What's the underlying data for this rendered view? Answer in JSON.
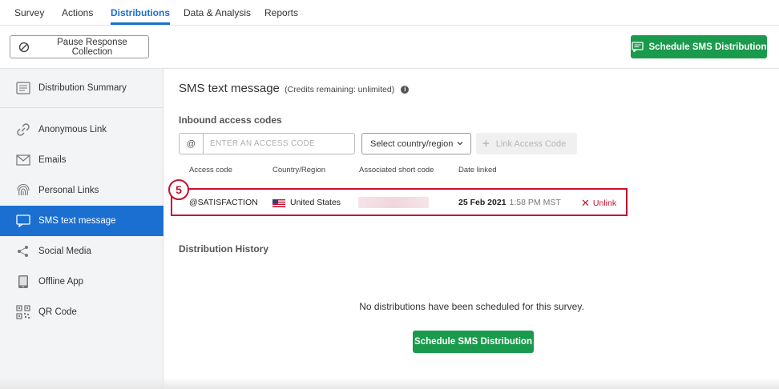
{
  "nav": {
    "tabs": [
      {
        "label": "Survey",
        "active": false
      },
      {
        "label": "Actions",
        "active": false
      },
      {
        "label": "Distributions",
        "active": true
      },
      {
        "label": "Data & Analysis",
        "active": false
      },
      {
        "label": "Reports",
        "active": false
      }
    ]
  },
  "toolbar": {
    "pause_label": "Pause Response Collection",
    "pause_icon": "pause-circle-icon",
    "schedule_label": "Schedule SMS Distribution",
    "schedule_icon": "sms-icon"
  },
  "sidebar": {
    "items": [
      {
        "label": "Distribution Summary",
        "icon": "summary-icon",
        "active": false
      },
      {
        "label": "Anonymous Link",
        "icon": "link-icon",
        "active": false
      },
      {
        "label": "Emails",
        "icon": "envelope-icon",
        "active": false
      },
      {
        "label": "Personal Links",
        "icon": "fingerprint-icon",
        "active": false
      },
      {
        "label": "SMS text message",
        "icon": "sms-icon",
        "active": true
      },
      {
        "label": "Social Media",
        "icon": "share-icon",
        "active": false
      },
      {
        "label": "Offline App",
        "icon": "tablet-icon",
        "active": false
      },
      {
        "label": "QR Code",
        "icon": "qr-code-icon",
        "active": false
      }
    ]
  },
  "main": {
    "title": "SMS text message",
    "credits": "(Credits remaining: unlimited)",
    "inbound_heading": "Inbound access codes",
    "at_symbol": "@",
    "code_placeholder": "ENTER AN ACCESS CODE",
    "country_select": "Select country/region",
    "link_button": "Link Access Code",
    "columns": [
      "Access code",
      "Country/Region",
      "Associated short code",
      "Date linked"
    ],
    "step_number": "5",
    "row": {
      "code": "@SATISFACTION",
      "country": "United States",
      "date": "25 Feb 2021",
      "time": "1:58 PM MST",
      "unlink": "Unlink"
    },
    "history_heading": "Distribution History",
    "empty_message": "No distributions have been scheduled for this survey.",
    "schedule_label": "Schedule SMS Distribution"
  },
  "colors": {
    "accent": "#1a6fd1",
    "green": "#1a9a4c",
    "highlight": "#c8102e"
  }
}
